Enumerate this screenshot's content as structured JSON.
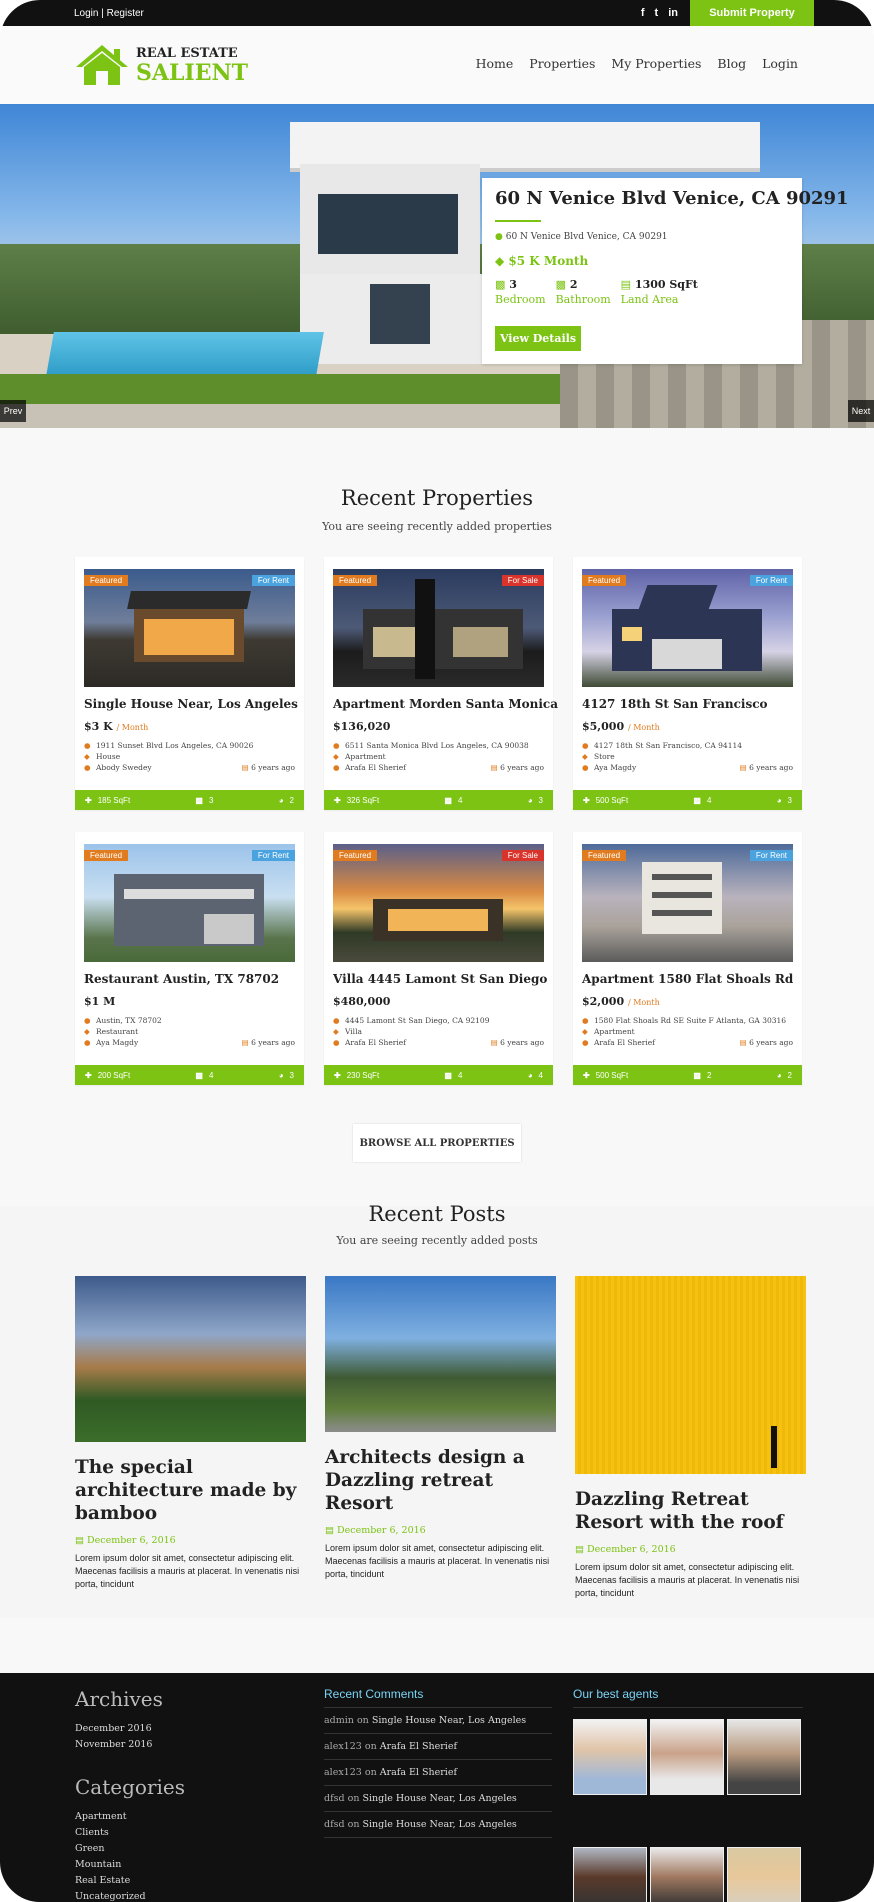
{
  "topbar": {
    "login_label": "Login | Register",
    "social": [
      "f",
      "t",
      "in"
    ],
    "submit_label": "Submit Property"
  },
  "brand": {
    "line1": "REAL ESTATE",
    "line2": "SALIENT",
    "color": "#7cc314"
  },
  "nav": [
    "Home",
    "Properties",
    "My Properties",
    "Blog",
    "Login"
  ],
  "hero": {
    "title": "60 N Venice Blvd Venice, CA 90291",
    "address": "60 N Venice Blvd Venice, CA 90291",
    "price": "$5 K Month",
    "bedrooms": "3",
    "bedrooms_label": "Bedroom",
    "bathrooms": "2",
    "bathrooms_label": "Bathroom",
    "area": "1300 SqFt",
    "area_label": "Land Area",
    "button": "View Details",
    "prev": "Prev",
    "next": "Next"
  },
  "recent_properties": {
    "heading": "Recent Properties",
    "sub": "You are seeing recently added properties",
    "items": [
      {
        "badge": "Featured",
        "status": "For Rent",
        "name": "Single House Near, Los Angeles",
        "price": "$3 K",
        "per": "/ Month",
        "address": "1911 Sunset Blvd Los Angeles, CA 90026",
        "type": "House",
        "agent": "Abody Swedey",
        "age": "6 years ago",
        "sqft": "185 SqFt",
        "beds": "3",
        "baths": "2"
      },
      {
        "badge": "Featured",
        "status": "For Sale",
        "name": "Apartment Morden Santa Monica",
        "price": "$136,020",
        "per": "",
        "address": "6511 Santa Monica Blvd Los Angeles, CA 90038",
        "type": "Apartment",
        "agent": "Arafa El Sherief",
        "age": "6 years ago",
        "sqft": "326 SqFt",
        "beds": "4",
        "baths": "3"
      },
      {
        "badge": "Featured",
        "status": "For Rent",
        "name": "4127 18th St San Francisco",
        "price": "$5,000",
        "per": "/ Month",
        "address": "4127 18th St San Francisco, CA 94114",
        "type": "Store",
        "agent": "Aya Magdy",
        "age": "6 years ago",
        "sqft": "500 SqFt",
        "beds": "4",
        "baths": "3"
      },
      {
        "badge": "Featured",
        "status": "For Rent",
        "name": "Restaurant Austin, TX 78702",
        "price": "$1 M",
        "per": "",
        "address": "Austin, TX 78702",
        "type": "Restaurant",
        "agent": "Aya Magdy",
        "age": "6 years ago",
        "sqft": "200 SqFt",
        "beds": "4",
        "baths": "3"
      },
      {
        "badge": "Featured",
        "status": "For Sale",
        "name": "Villa 4445 Lamont St San Diego",
        "price": "$480,000",
        "per": "",
        "address": "4445 Lamont St San Diego, CA 92109",
        "type": "Villa",
        "agent": "Arafa El Sherief",
        "age": "6 years ago",
        "sqft": "230 SqFt",
        "beds": "4",
        "baths": "4"
      },
      {
        "badge": "Featured",
        "status": "For Rent",
        "name": "Apartment 1580 Flat Shoals Rd",
        "price": "$2,000",
        "per": "/ Month",
        "address": "1580 Flat Shoals Rd SE Suite F Atlanta, GA 30316",
        "type": "Apartment",
        "agent": "Arafa El Sherief",
        "age": "6 years ago",
        "sqft": "500 SqFt",
        "beds": "2",
        "baths": "2"
      }
    ],
    "browse": "BROWSE ALL PROPERTIES"
  },
  "recent_posts": {
    "heading": "Recent Posts",
    "sub": "You are seeing recently added posts",
    "items": [
      {
        "title": "The special architecture made by bamboo",
        "date": "December 6, 2016",
        "body": "Lorem ipsum dolor sit amet, consectetur adipiscing elit. Maecenas facilisis a mauris at placerat. In venenatis nisi porta, tincidunt"
      },
      {
        "title": "Architects design a Dazzling retreat Resort",
        "date": "December 6, 2016",
        "body": "Lorem ipsum dolor sit amet, consectetur adipiscing elit. Maecenas facilisis a mauris at placerat. In venenatis nisi porta, tincidunt"
      },
      {
        "title": "Dazzling Retreat Resort with the roof",
        "date": "December 6, 2016",
        "body": "Lorem ipsum dolor sit amet, consectetur adipiscing elit. Maecenas facilisis a mauris at placerat. In venenatis nisi porta, tincidunt"
      }
    ]
  },
  "footer": {
    "archives_heading": "Archives",
    "archives": [
      "December 2016",
      "November 2016"
    ],
    "categories_heading": "Categories",
    "categories": [
      "Apartment",
      "Clients",
      "Green",
      "Mountain",
      "Real Estate",
      "Uncategorized"
    ],
    "comments_heading": "Recent Comments",
    "comments": [
      {
        "who": "admin",
        "on": "on",
        "post": "Single House Near, Los Angeles"
      },
      {
        "who": "alex123",
        "on": "on",
        "post": "Arafa El Sherief"
      },
      {
        "who": "alex123",
        "on": "on",
        "post": "Arafa El Sherief"
      },
      {
        "who": "dfsd",
        "on": "on",
        "post": "Single House Near, Los Angeles"
      },
      {
        "who": "dfsd",
        "on": "on",
        "post": "Single House Near, Los Angeles"
      }
    ],
    "agents_heading": "Our best agents"
  }
}
